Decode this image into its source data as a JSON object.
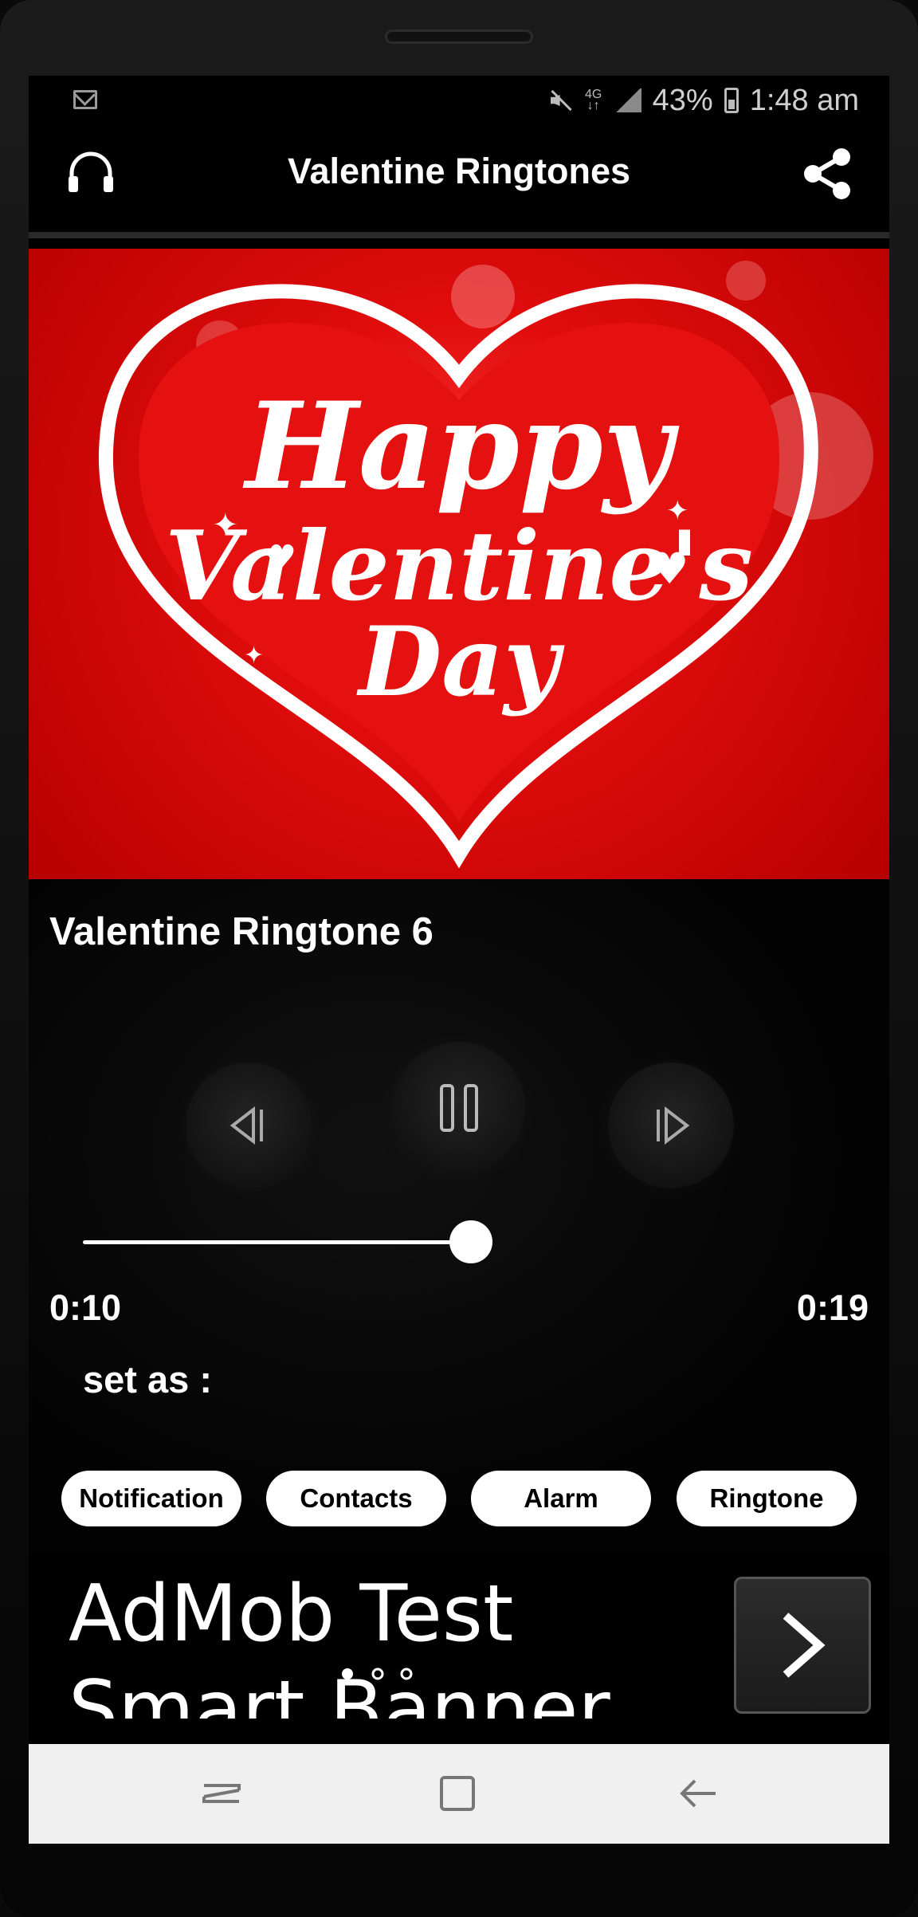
{
  "statusbar": {
    "notification_icon": "mail-icon",
    "icons": [
      "mute-icon",
      "network-4g-icon",
      "signal-icon",
      "battery-icon"
    ],
    "battery": "43%",
    "time": "1:48 am"
  },
  "toolbar": {
    "title": "Valentine Ringtones",
    "left_icon": "headphones-icon",
    "right_icon": "share-icon"
  },
  "hero": {
    "line1": "Happy",
    "line2": "Valentine's",
    "line3": "Day"
  },
  "player": {
    "track_title": "Valentine Ringtone 6",
    "controls": [
      "previous-icon",
      "pause-icon",
      "next-icon"
    ],
    "elapsed": "0:10",
    "total": "0:19",
    "progress_fraction": 0.53
  },
  "set_as": {
    "label": "set as :",
    "options": [
      "Notification",
      "Contacts",
      "Alarm",
      "Ringtone"
    ]
  },
  "ad": {
    "title": "AdMob Test",
    "subtitle": "Smart Banner",
    "button_icon": "chevron-right-icon"
  },
  "navbar": {
    "buttons": [
      "recent-apps-icon",
      "home-icon",
      "back-icon"
    ]
  },
  "colors": {
    "accent_red": "#e00c0c",
    "background": "#000000",
    "chip_bg": "#ffffff"
  }
}
